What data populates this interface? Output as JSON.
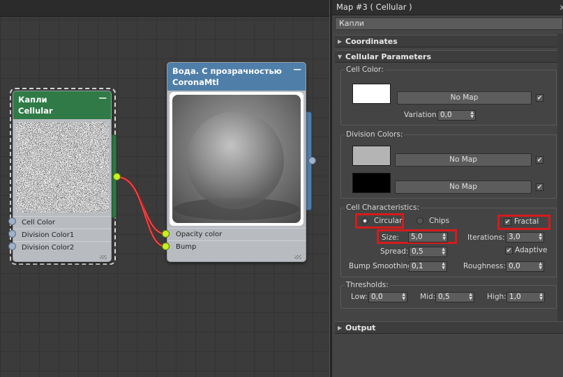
{
  "node_editor": {
    "node_cellular": {
      "title": "Капли",
      "subtitle": "Cellular",
      "collapse_label": "—",
      "ports": [
        "Cell Color",
        "Division Color1",
        "Division Color2"
      ],
      "header_color": "#2f7a46"
    },
    "node_material": {
      "title": "Вода. С прозрачностью",
      "subtitle": "CoronaMtl",
      "collapse_label": "—",
      "ports": [
        "Opacity color",
        "Bump"
      ],
      "header_color": "#4f7fa9"
    }
  },
  "panel": {
    "title": "Map #3  ( Cellular )",
    "close_label": "x",
    "map_name": "Капли",
    "rollouts": {
      "coordinates": "Coordinates",
      "cellular_parameters": "Cellular Parameters",
      "output": "Output"
    },
    "cell_color": {
      "group_label": "Cell Color:",
      "swatch_color": "#ffffff",
      "map_label": "No Map",
      "map_checked": "✔",
      "variation_label": "Variation:",
      "variation_value": "0,0"
    },
    "division_colors": {
      "group_label": "Division Colors:",
      "swatch1_color": "#b4b4b4",
      "swatch2_color": "#000000",
      "map1_label": "No Map",
      "map2_label": "No Map",
      "map1_checked": "✔",
      "map2_checked": "✔"
    },
    "cell_characteristics": {
      "group_label": "Cell Characteristics:",
      "circular_label": "Circular",
      "chips_label": "Chips",
      "fractal_label": "Fractal",
      "fractal_checked": "✔",
      "size_label": "Size:",
      "size_value": "5,0",
      "iterations_label": "Iterations:",
      "iterations_value": "3,0",
      "spread_label": "Spread:",
      "spread_value": "0,5",
      "adaptive_label": "Adaptive",
      "adaptive_checked": "✔",
      "bump_smoothing_label": "Bump Smoothing:",
      "bump_smoothing_value": "0,1",
      "roughness_label": "Roughness:",
      "roughness_value": "0,0"
    },
    "thresholds": {
      "group_label": "Thresholds:",
      "low_label": "Low:",
      "low_value": "0,0",
      "mid_label": "Mid:",
      "mid_value": "0,5",
      "high_label": "High:",
      "high_value": "1,0"
    },
    "highlight_color": "#d61b1b"
  }
}
